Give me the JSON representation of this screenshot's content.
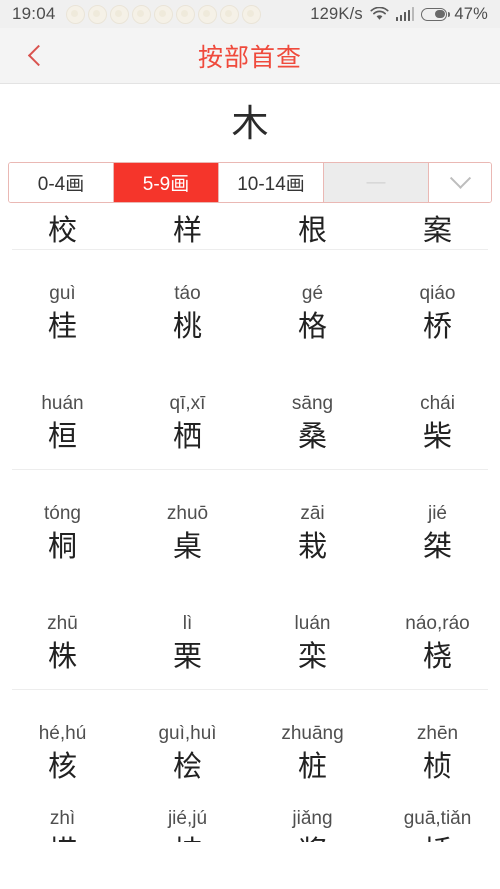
{
  "status_bar": {
    "clock": "19:04",
    "notification_icon_count": 9,
    "notification_icon_name": "app-notification-icon",
    "network_speed": "129K/s",
    "wifi_icon": "wifi-icon",
    "signal_icon": "cellular-signal-icon",
    "battery_icon": "battery-icon",
    "battery_percent": "47%",
    "battery_level": 47,
    "background_color": "#f0f0f0",
    "text_color": "#4d4d4d"
  },
  "nav_bar": {
    "back_icon": "chevron-left-icon",
    "title": "按部首查",
    "title_color": "#ef4a3c",
    "background_color": "#f4f4f4"
  },
  "radical": {
    "character": "木"
  },
  "stroke_tabs": {
    "border_color": "#eab8b4",
    "active_color": "#f5352b",
    "items": [
      {
        "label": "0-4画",
        "state": "normal"
      },
      {
        "label": "5-9画",
        "state": "active"
      },
      {
        "label": "10-14画",
        "state": "normal"
      },
      {
        "label": "—",
        "state": "disabled"
      }
    ],
    "expand_icon": "chevron-down-icon"
  },
  "character_grid": {
    "columns": 4,
    "rows": [
      {
        "clipped_top": true,
        "cells": [
          {
            "pinyin": "",
            "hanzi": "校"
          },
          {
            "pinyin": "",
            "hanzi": "样"
          },
          {
            "pinyin": "",
            "hanzi": "根"
          },
          {
            "pinyin": "",
            "hanzi": "案"
          }
        ]
      },
      {
        "cells": [
          {
            "pinyin": "guì",
            "hanzi": "桂"
          },
          {
            "pinyin": "táo",
            "hanzi": "桃"
          },
          {
            "pinyin": "gé",
            "hanzi": "格"
          },
          {
            "pinyin": "qiáo",
            "hanzi": "桥"
          }
        ]
      },
      {
        "cells": [
          {
            "pinyin": "huán",
            "hanzi": "桓"
          },
          {
            "pinyin": "qī,xī",
            "hanzi": "栖"
          },
          {
            "pinyin": "sāng",
            "hanzi": "桑"
          },
          {
            "pinyin": "chái",
            "hanzi": "柴"
          }
        ]
      },
      {
        "cells": [
          {
            "pinyin": "tóng",
            "hanzi": "桐"
          },
          {
            "pinyin": "zhuō",
            "hanzi": "桌"
          },
          {
            "pinyin": "zāi",
            "hanzi": "栽"
          },
          {
            "pinyin": "jié",
            "hanzi": "桀"
          }
        ]
      },
      {
        "cells": [
          {
            "pinyin": "zhū",
            "hanzi": "株"
          },
          {
            "pinyin": "lì",
            "hanzi": "栗"
          },
          {
            "pinyin": "luán",
            "hanzi": "栾"
          },
          {
            "pinyin": "náo,ráo",
            "hanzi": "桡"
          }
        ]
      },
      {
        "cells": [
          {
            "pinyin": "hé,hú",
            "hanzi": "核"
          },
          {
            "pinyin": "guì,huì",
            "hanzi": "桧"
          },
          {
            "pinyin": "zhuāng",
            "hanzi": "桩"
          },
          {
            "pinyin": "zhēn",
            "hanzi": "桢"
          }
        ]
      },
      {
        "clipped_bottom": true,
        "cells": [
          {
            "pinyin": "zhì",
            "hanzi": "栉"
          },
          {
            "pinyin": "jié,jú",
            "hanzi": "桔"
          },
          {
            "pinyin": "jiǎng",
            "hanzi": "桨"
          },
          {
            "pinyin": "guā,tiǎn",
            "hanzi": "栝"
          }
        ]
      }
    ]
  }
}
